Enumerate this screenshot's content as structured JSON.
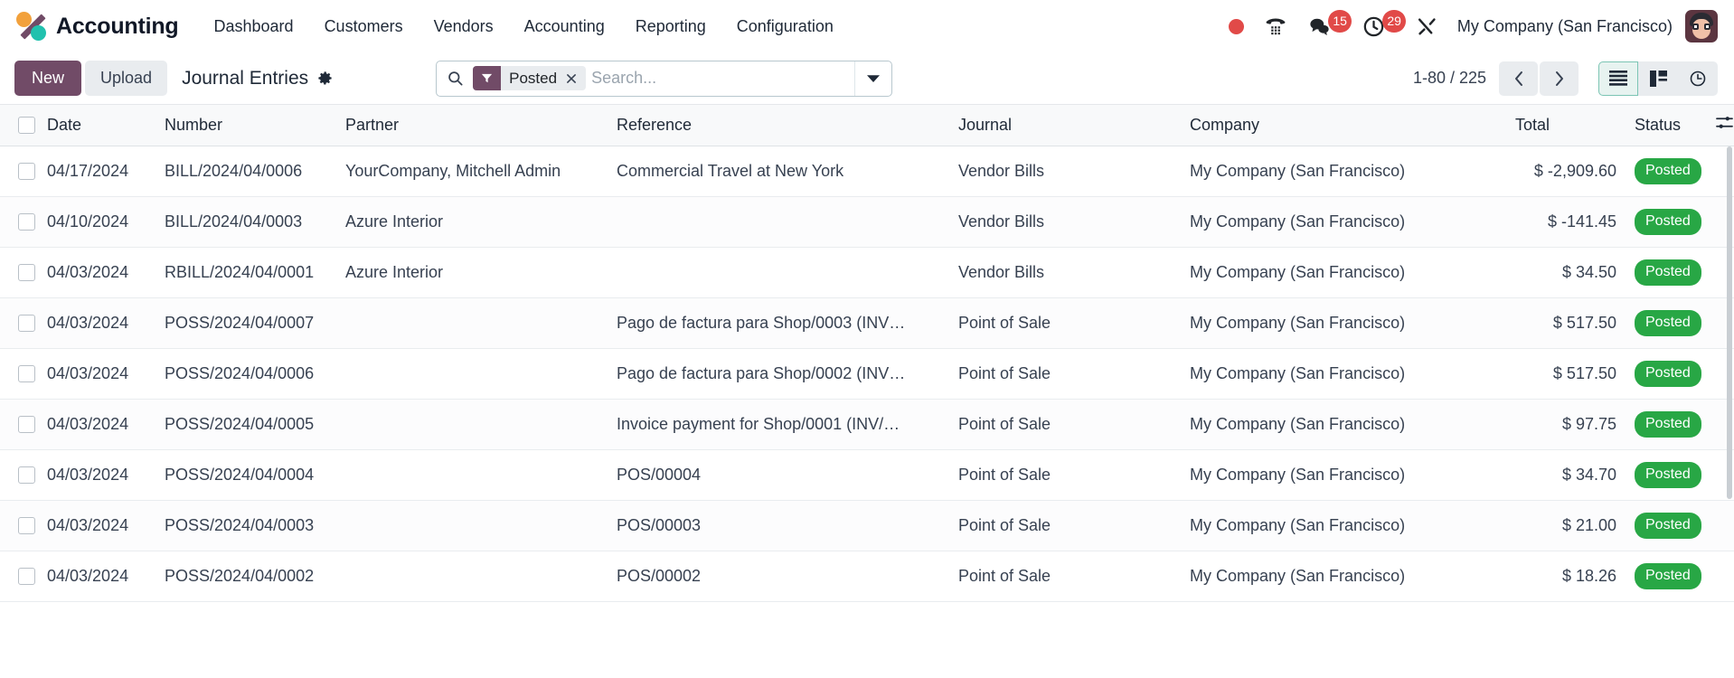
{
  "navbar": {
    "brand": "Accounting",
    "logo_icon": "odoo-logo-icon",
    "menu": [
      {
        "label": "Dashboard",
        "name": "nav-dashboard"
      },
      {
        "label": "Customers",
        "name": "nav-customers"
      },
      {
        "label": "Vendors",
        "name": "nav-vendors"
      },
      {
        "label": "Accounting",
        "name": "nav-accounting"
      },
      {
        "label": "Reporting",
        "name": "nav-reporting"
      },
      {
        "label": "Configuration",
        "name": "nav-configuration"
      }
    ],
    "systray": {
      "record_icon": "record-dot-icon",
      "phone_icon": "phone-dialpad-icon",
      "messages_icon": "chat-bubbles-icon",
      "messages_count": "15",
      "activities_icon": "clock-activities-icon",
      "activities_count": "29",
      "tools_icon": "wrench-tools-icon",
      "company": "My Company (San Francisco)",
      "avatar_icon": "user-avatar-icon"
    }
  },
  "control_panel": {
    "new_label": "New",
    "upload_label": "Upload",
    "breadcrumb": "Journal Entries",
    "settings_icon": "gear-icon",
    "search": {
      "search_icon": "search-icon",
      "facet_icon": "filter-funnel-icon",
      "facet_label": "Posted",
      "facet_close_icon": "close-x-icon",
      "placeholder": "Search...",
      "value": "",
      "toggle_icon": "chevron-down-icon"
    },
    "pager": {
      "range": "1-80 / 225",
      "prev_icon": "chevron-left-icon",
      "next_icon": "chevron-right-icon"
    },
    "views": [
      {
        "name": "view-list",
        "icon": "list-view-icon",
        "active": true
      },
      {
        "name": "view-kanban",
        "icon": "kanban-view-icon",
        "active": false
      },
      {
        "name": "view-activity",
        "icon": "activity-clock-icon",
        "active": false
      }
    ]
  },
  "table": {
    "select_all_icon": "checkbox-icon",
    "optional_columns_icon": "sliders-settings-icon",
    "columns": [
      "Date",
      "Number",
      "Partner",
      "Reference",
      "Journal",
      "Company",
      "Total",
      "Status"
    ],
    "rows": [
      {
        "date": "04/17/2024",
        "number": "BILL/2024/04/0006",
        "partner": "YourCompany, Mitchell Admin",
        "reference": "Commercial Travel at New York",
        "journal": "Vendor Bills",
        "company": "My Company (San Francisco)",
        "total": "$ -2,909.60",
        "status": "Posted"
      },
      {
        "date": "04/10/2024",
        "number": "BILL/2024/04/0003",
        "partner": "Azure Interior",
        "reference": "",
        "journal": "Vendor Bills",
        "company": "My Company (San Francisco)",
        "total": "$ -141.45",
        "status": "Posted"
      },
      {
        "date": "04/03/2024",
        "number": "RBILL/2024/04/0001",
        "partner": "Azure Interior",
        "reference": "",
        "journal": "Vendor Bills",
        "company": "My Company (San Francisco)",
        "total": "$ 34.50",
        "status": "Posted"
      },
      {
        "date": "04/03/2024",
        "number": "POSS/2024/04/0007",
        "partner": "",
        "reference": "Pago de factura para Shop/0003 (INV…",
        "journal": "Point of Sale",
        "company": "My Company (San Francisco)",
        "total": "$ 517.50",
        "status": "Posted"
      },
      {
        "date": "04/03/2024",
        "number": "POSS/2024/04/0006",
        "partner": "",
        "reference": "Pago de factura para Shop/0002 (INV…",
        "journal": "Point of Sale",
        "company": "My Company (San Francisco)",
        "total": "$ 517.50",
        "status": "Posted"
      },
      {
        "date": "04/03/2024",
        "number": "POSS/2024/04/0005",
        "partner": "",
        "reference": "Invoice payment for Shop/0001 (INV/…",
        "journal": "Point of Sale",
        "company": "My Company (San Francisco)",
        "total": "$ 97.75",
        "status": "Posted"
      },
      {
        "date": "04/03/2024",
        "number": "POSS/2024/04/0004",
        "partner": "",
        "reference": "POS/00004",
        "journal": "Point of Sale",
        "company": "My Company (San Francisco)",
        "total": "$ 34.70",
        "status": "Posted"
      },
      {
        "date": "04/03/2024",
        "number": "POSS/2024/04/0003",
        "partner": "",
        "reference": "POS/00003",
        "journal": "Point of Sale",
        "company": "My Company (San Francisco)",
        "total": "$ 21.00",
        "status": "Posted"
      },
      {
        "date": "04/03/2024",
        "number": "POSS/2024/04/0002",
        "partner": "",
        "reference": "POS/00002",
        "journal": "Point of Sale",
        "company": "My Company (San Francisco)",
        "total": "$ 18.26",
        "status": "Posted"
      }
    ]
  },
  "colors": {
    "primary": "#714b67",
    "success": "#28a745",
    "danger": "#e14a48",
    "accent_teal": "#21c1ae",
    "accent_orange": "#f2a13c"
  }
}
